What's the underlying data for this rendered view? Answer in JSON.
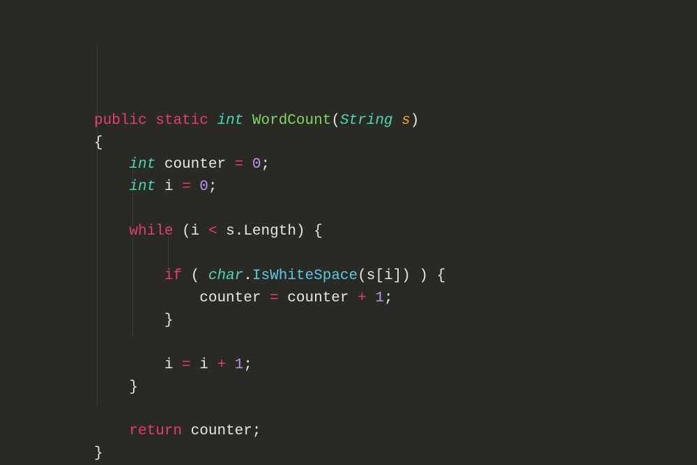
{
  "colors": {
    "background": "#2a2a24",
    "keyword": "#e63d6f",
    "type": "#48d8b8",
    "function": "#7fd860",
    "variable": "#e8e8e0",
    "parameter": "#f89838",
    "operator": "#e63d6f",
    "punctuation": "#e8e8e0",
    "number": "#b893f2",
    "method": "#5bc8e8"
  },
  "tokens": {
    "public": "public",
    "static": "static",
    "int": "int",
    "WordCount": "WordCount",
    "String": "String",
    "s": "s",
    "counter": "counter",
    "i": "i",
    "zero": "0",
    "one": "1",
    "while": "while",
    "Length": "Length",
    "if": "if",
    "char": "char",
    "IsWhiteSpace": "IsWhiteSpace",
    "return": "return",
    "eq": "=",
    "lt": "<",
    "plus": "+",
    "semi": ";",
    "lparen": "(",
    "rparen": ")",
    "lbrace": "{",
    "rbrace": "}",
    "lbracket": "[",
    "rbracket": "]",
    "dot": "."
  },
  "code_plain": "public static int WordCount(String s)\n{\n    int counter = 0;\n    int i = 0;\n\n    while (i < s.Length) {\n\n        if ( char.IsWhiteSpace(s[i]) ) {\n            counter = counter + 1;\n        }\n\n        i = i + 1;\n    }\n\n    return counter;\n}"
}
